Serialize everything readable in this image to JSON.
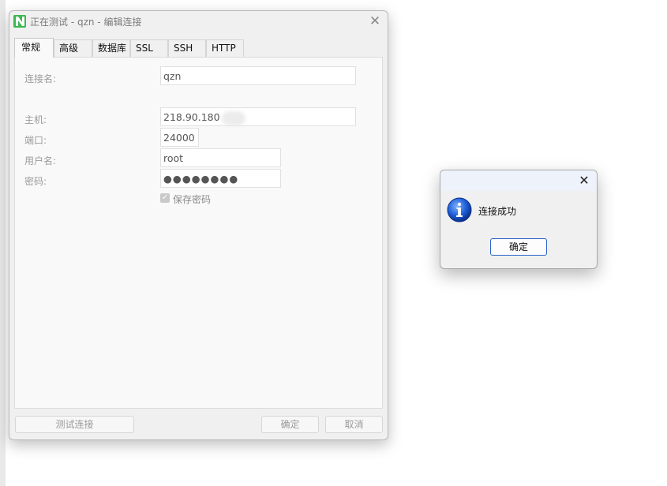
{
  "main_window": {
    "title": "正在测试 - qzn - 编辑连接",
    "close_glyph": "✕"
  },
  "tabs": [
    {
      "label": "常规",
      "active": true
    },
    {
      "label": "高级",
      "active": false
    },
    {
      "label": "数据库",
      "active": false
    },
    {
      "label": "SSL",
      "active": false
    },
    {
      "label": "SSH",
      "active": false
    },
    {
      "label": "HTTP",
      "active": false
    }
  ],
  "form": {
    "connection_name_label": "连接名:",
    "connection_name_value": "qzn",
    "host_label": "主机:",
    "host_value": "218.90.180",
    "port_label": "端口:",
    "port_value": "24000",
    "username_label": "用户名:",
    "username_value": "root",
    "password_label": "密码:",
    "password_value": "●●●●●●●●",
    "save_password_label": "保存密码",
    "save_password_checked": true
  },
  "buttons": {
    "test_connection": "测试连接",
    "ok": "确定",
    "cancel": "取消"
  },
  "popup": {
    "close_glyph": "✕",
    "message": "连接成功",
    "ok_label": "确定",
    "icon": "info-icon",
    "icon_color": "#1e5fd6"
  },
  "colors": {
    "accent_blue": "#2b63c9",
    "app_icon_green": "#3cb851"
  }
}
